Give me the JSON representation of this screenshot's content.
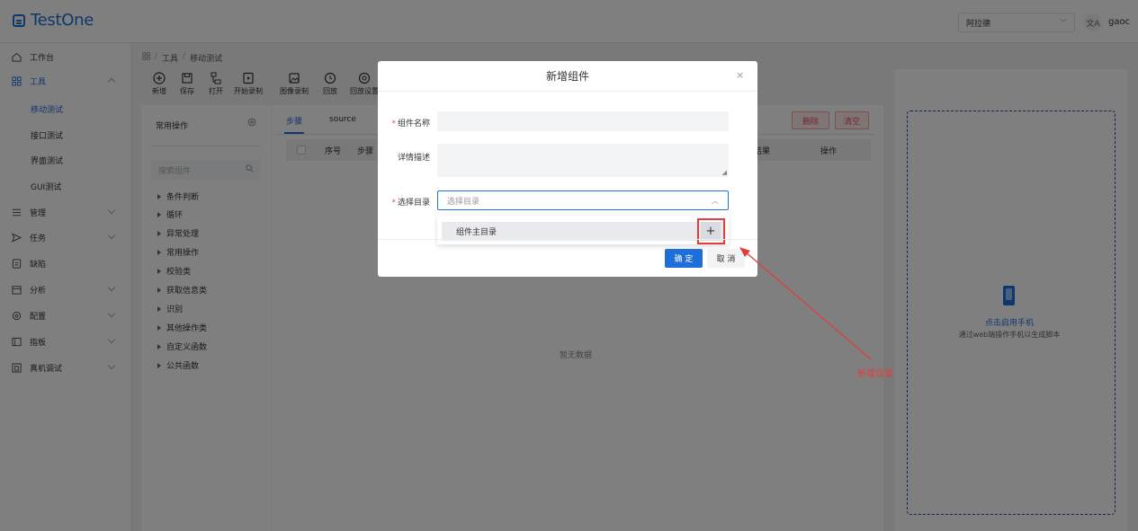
{
  "header": {
    "logo_text": "TestOne",
    "region_value": "阿拉德",
    "user_name": "gaoc"
  },
  "sidebar": {
    "items": [
      {
        "label": "工作台",
        "icon": "home-icon"
      },
      {
        "label": "工具",
        "icon": "grid-icon",
        "active": true,
        "expanded": true
      },
      {
        "label": "管理",
        "icon": "list-icon"
      },
      {
        "label": "任务",
        "icon": "send-icon"
      },
      {
        "label": "缺陷",
        "icon": "bug-icon"
      },
      {
        "label": "分析",
        "icon": "calendar-icon"
      },
      {
        "label": "配置",
        "icon": "gear-icon"
      },
      {
        "label": "指板",
        "icon": "board-icon"
      },
      {
        "label": "真机调试",
        "icon": "device-icon"
      }
    ],
    "tool_subitems": [
      {
        "label": "移动测试",
        "active": true
      },
      {
        "label": "接口测试"
      },
      {
        "label": "界面测试"
      },
      {
        "label": "GUI测试"
      }
    ]
  },
  "breadcrumb": {
    "sep": "/",
    "items": [
      "工具",
      "移动测试"
    ]
  },
  "toolbar": {
    "items": [
      {
        "label": "新增",
        "icon": "plus-circle-icon"
      },
      {
        "label": "保存",
        "icon": "save-icon"
      },
      {
        "label": "打开",
        "icon": "folder-tree-icon"
      },
      {
        "label": "开始录制",
        "icon": "record-icon"
      },
      {
        "label": "图像录制",
        "icon": "image-icon"
      },
      {
        "label": "回放",
        "icon": "replay-icon"
      },
      {
        "label": "回放设置",
        "icon": "gear-icon"
      }
    ]
  },
  "left_panel": {
    "title": "常用操作",
    "search_placeholder": "搜索组件",
    "tree": [
      "条件判断",
      "循环",
      "异常处理",
      "常用操作",
      "校验类",
      "获取信息类",
      "识别",
      "其他操作类",
      "自定义函数",
      "公共函数"
    ]
  },
  "main_panel": {
    "tabs": [
      "步骤",
      "source"
    ],
    "delete_label": "删除",
    "clear_label": "清空",
    "columns": [
      "序号",
      "步骤",
      "结果",
      "操作"
    ],
    "empty_text": "暂无数据"
  },
  "right_panel": {
    "start_phone": "点击启用手机",
    "start_phone_desc": "通过web端操作手机以生成脚本"
  },
  "dialog": {
    "title": "新增组件",
    "close": "×",
    "name_label": "组件名称",
    "desc_label": "详情描述",
    "dir_label": "选择目录",
    "dir_placeholder": "选择目录",
    "dir_option": "组件主目录",
    "add_dir_symbol": "+",
    "ok_label": "确 定",
    "cancel_label": "取 消"
  },
  "annotation": {
    "text": "新增目录",
    "color": "#e63b3b"
  },
  "colors": {
    "primary": "#1e6fd9",
    "danger": "#e34d59",
    "annotation": "#e63b3b"
  }
}
